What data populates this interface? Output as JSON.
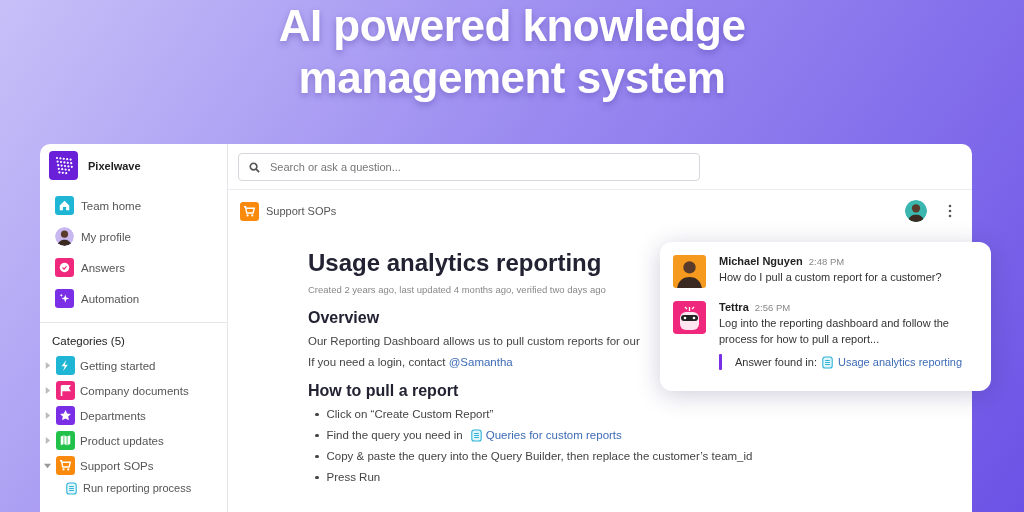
{
  "headline": [
    "AI powered knowledge",
    "management system"
  ],
  "workspace": {
    "name": "Pixelwave"
  },
  "nav": [
    {
      "label": "Team home",
      "kind": "home"
    },
    {
      "label": "My profile",
      "kind": "avatar"
    },
    {
      "label": "Answers",
      "kind": "answers"
    },
    {
      "label": "Automation",
      "kind": "automation"
    }
  ],
  "categories": {
    "title": "Categories (5)",
    "items": [
      {
        "label": "Getting started",
        "kind": "bolt",
        "expanded": false
      },
      {
        "label": "Company documents",
        "kind": "flag",
        "expanded": false
      },
      {
        "label": "Departments",
        "kind": "star",
        "expanded": false
      },
      {
        "label": "Product updates",
        "kind": "map",
        "expanded": false
      },
      {
        "label": "Support SOPs",
        "kind": "cart",
        "expanded": true,
        "children": [
          {
            "label": "Run reporting process"
          }
        ]
      }
    ]
  },
  "search": {
    "placeholder": "Search or ask a question..."
  },
  "breadcrumb": "Support SOPs",
  "article": {
    "title": "Usage analytics reporting",
    "meta": "Created 2 years ago, last updated 4 months ago, verified two days ago",
    "sections": [
      {
        "heading": "Overview",
        "kind": "paragraphs",
        "lines": [
          {
            "text": "Our Reporting Dashboard allows us to pull custom reports for our"
          },
          {
            "text": "If you need a login, contact ",
            "link": {
              "label": "@Samantha",
              "kind": "mention"
            }
          }
        ]
      },
      {
        "heading": "How to pull a report",
        "kind": "bullets",
        "lines": [
          {
            "text": "Click on “Create Custom Report”"
          },
          {
            "text": "Find the query you need in ",
            "link": {
              "label": "Queries for custom reports",
              "kind": "doc"
            }
          },
          {
            "text": "Copy & paste the query into the Query Builder, then replace the customer’s team_id"
          },
          {
            "text": "Press Run"
          }
        ]
      }
    ]
  },
  "chat": {
    "messages": [
      {
        "author": "Michael Nguyen",
        "time": "2:48 PM",
        "kind": "person",
        "text": "How do I pull a custom report for a customer?"
      },
      {
        "author": "Tettra",
        "time": "2:56 PM",
        "kind": "bot",
        "text": "Log into the reporting dashboard and follow the process for how to pull a report...",
        "source": {
          "label": "Answer found in:",
          "link": "Usage analytics reporting"
        }
      }
    ]
  }
}
